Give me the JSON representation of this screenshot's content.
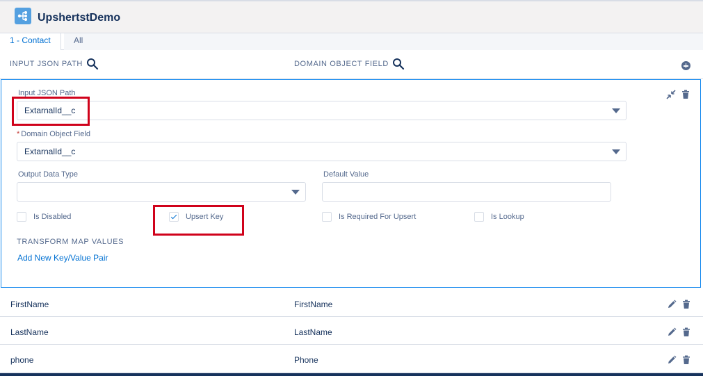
{
  "app": {
    "title": "UpshertstDemo",
    "icon": "sitemap-icon",
    "accent": "#54a0e0"
  },
  "tabs": [
    {
      "label": "1 - Contact",
      "active": true
    },
    {
      "label": "All",
      "active": false
    }
  ],
  "columns": {
    "input_json_path": "INPUT JSON PATH",
    "domain_object_field": "DOMAIN OBJECT FIELD"
  },
  "editor": {
    "input_json_path_label": "Input JSON Path",
    "input_json_path_value": "ExtarnalId__c",
    "domain_object_field_required": "*",
    "domain_object_field_label": "Domain Object Field",
    "domain_object_field_value": "ExtarnalId__c",
    "output_data_type_label": "Output Data Type",
    "output_data_type_value": "",
    "default_value_label": "Default Value",
    "default_value_value": "",
    "checkboxes": [
      {
        "label": "Is Disabled",
        "checked": false
      },
      {
        "label": "Upsert Key",
        "checked": true
      },
      {
        "label": "Is Required For Upsert",
        "checked": false
      },
      {
        "label": "Is Lookup",
        "checked": false
      }
    ],
    "transform_label": "TRANSFORM MAP VALUES",
    "add_pair_link": "Add New Key/Value Pair"
  },
  "rows": [
    {
      "input": "FirstName",
      "field": "FirstName"
    },
    {
      "input": "LastName",
      "field": "LastName"
    },
    {
      "input": "phone",
      "field": "Phone"
    }
  ],
  "colors": {
    "link": "#0070d2",
    "highlight": "#d0021b",
    "focus_border": "#1589ee"
  }
}
